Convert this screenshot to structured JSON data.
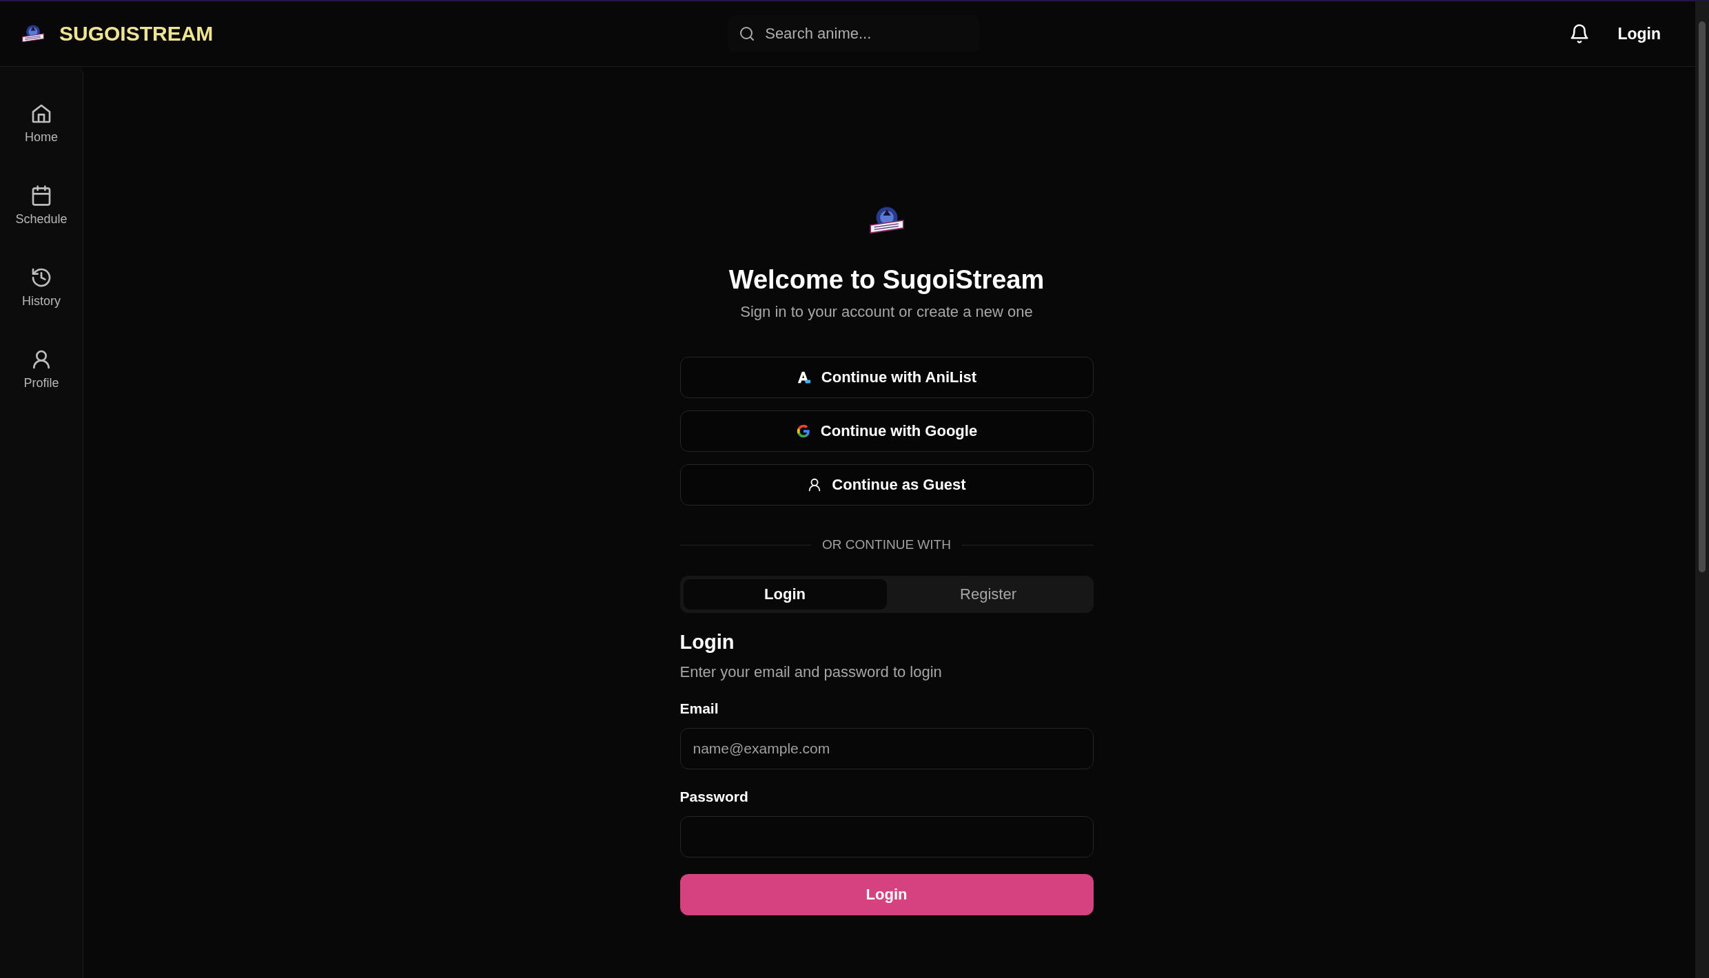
{
  "header": {
    "brand": "SUGOISTREAM",
    "search": {
      "placeholder": "Search anime..."
    },
    "login_link": "Login"
  },
  "sidebar": {
    "items": [
      {
        "label": "Home"
      },
      {
        "label": "Schedule"
      },
      {
        "label": "History"
      },
      {
        "label": "Profile"
      }
    ]
  },
  "auth": {
    "title": "Welcome to SugoiStream",
    "subtitle": "Sign in to your account or create a new one",
    "providers": [
      {
        "label": "Continue with AniList"
      },
      {
        "label": "Continue with Google"
      },
      {
        "label": "Continue as Guest"
      }
    ],
    "divider": "OR CONTINUE WITH",
    "tabs": [
      {
        "label": "Login",
        "selected": true
      },
      {
        "label": "Register",
        "selected": false
      }
    ],
    "form": {
      "title": "Login",
      "description": "Enter your email and password to login",
      "fields": [
        {
          "label": "Email",
          "placeholder": "name@example.com"
        },
        {
          "label": "Password"
        }
      ],
      "submit": "Login"
    }
  }
}
